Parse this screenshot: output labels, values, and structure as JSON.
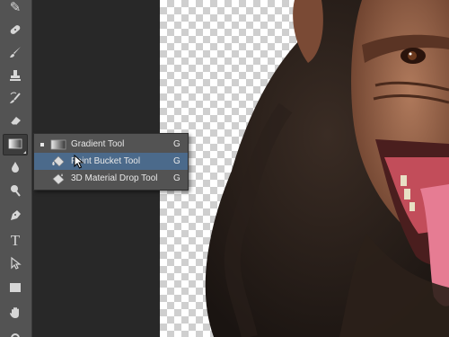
{
  "toolbar": {
    "tools": [
      {
        "name": "eyedropper-icon",
        "glyph": "✎"
      },
      {
        "name": "healing-brush-icon",
        "glyph": "✚"
      },
      {
        "name": "brush-icon",
        "glyph": "✏"
      },
      {
        "name": "clone-stamp-icon",
        "glyph": "⛶"
      },
      {
        "name": "history-brush-icon",
        "glyph": "↺"
      },
      {
        "name": "eraser-icon",
        "glyph": "▱"
      },
      {
        "name": "gradient-tool-icon",
        "glyph": ""
      },
      {
        "name": "blur-icon",
        "glyph": "💧"
      },
      {
        "name": "dodge-icon",
        "glyph": "●"
      },
      {
        "name": "pen-icon",
        "glyph": "✒"
      },
      {
        "name": "type-icon",
        "glyph": "T"
      },
      {
        "name": "path-selection-icon",
        "glyph": "➤"
      },
      {
        "name": "rectangle-icon",
        "glyph": "▭"
      },
      {
        "name": "hand-icon",
        "glyph": "✋"
      }
    ]
  },
  "flyout": {
    "items": [
      {
        "label": "Gradient Tool",
        "shortcut": "G",
        "icon": "gradient-icon",
        "current": true,
        "hovered": false
      },
      {
        "label": "Paint Bucket Tool",
        "shortcut": "G",
        "icon": "paint-bucket-icon",
        "current": false,
        "hovered": true
      },
      {
        "label": "3D Material Drop Tool",
        "shortcut": "G",
        "icon": "3d-material-drop-icon",
        "current": false,
        "hovered": false
      }
    ]
  },
  "colors": {
    "toolbar_bg": "#535353",
    "workspace_bg": "#282828",
    "menu_highlight": "#4b6a8b"
  }
}
